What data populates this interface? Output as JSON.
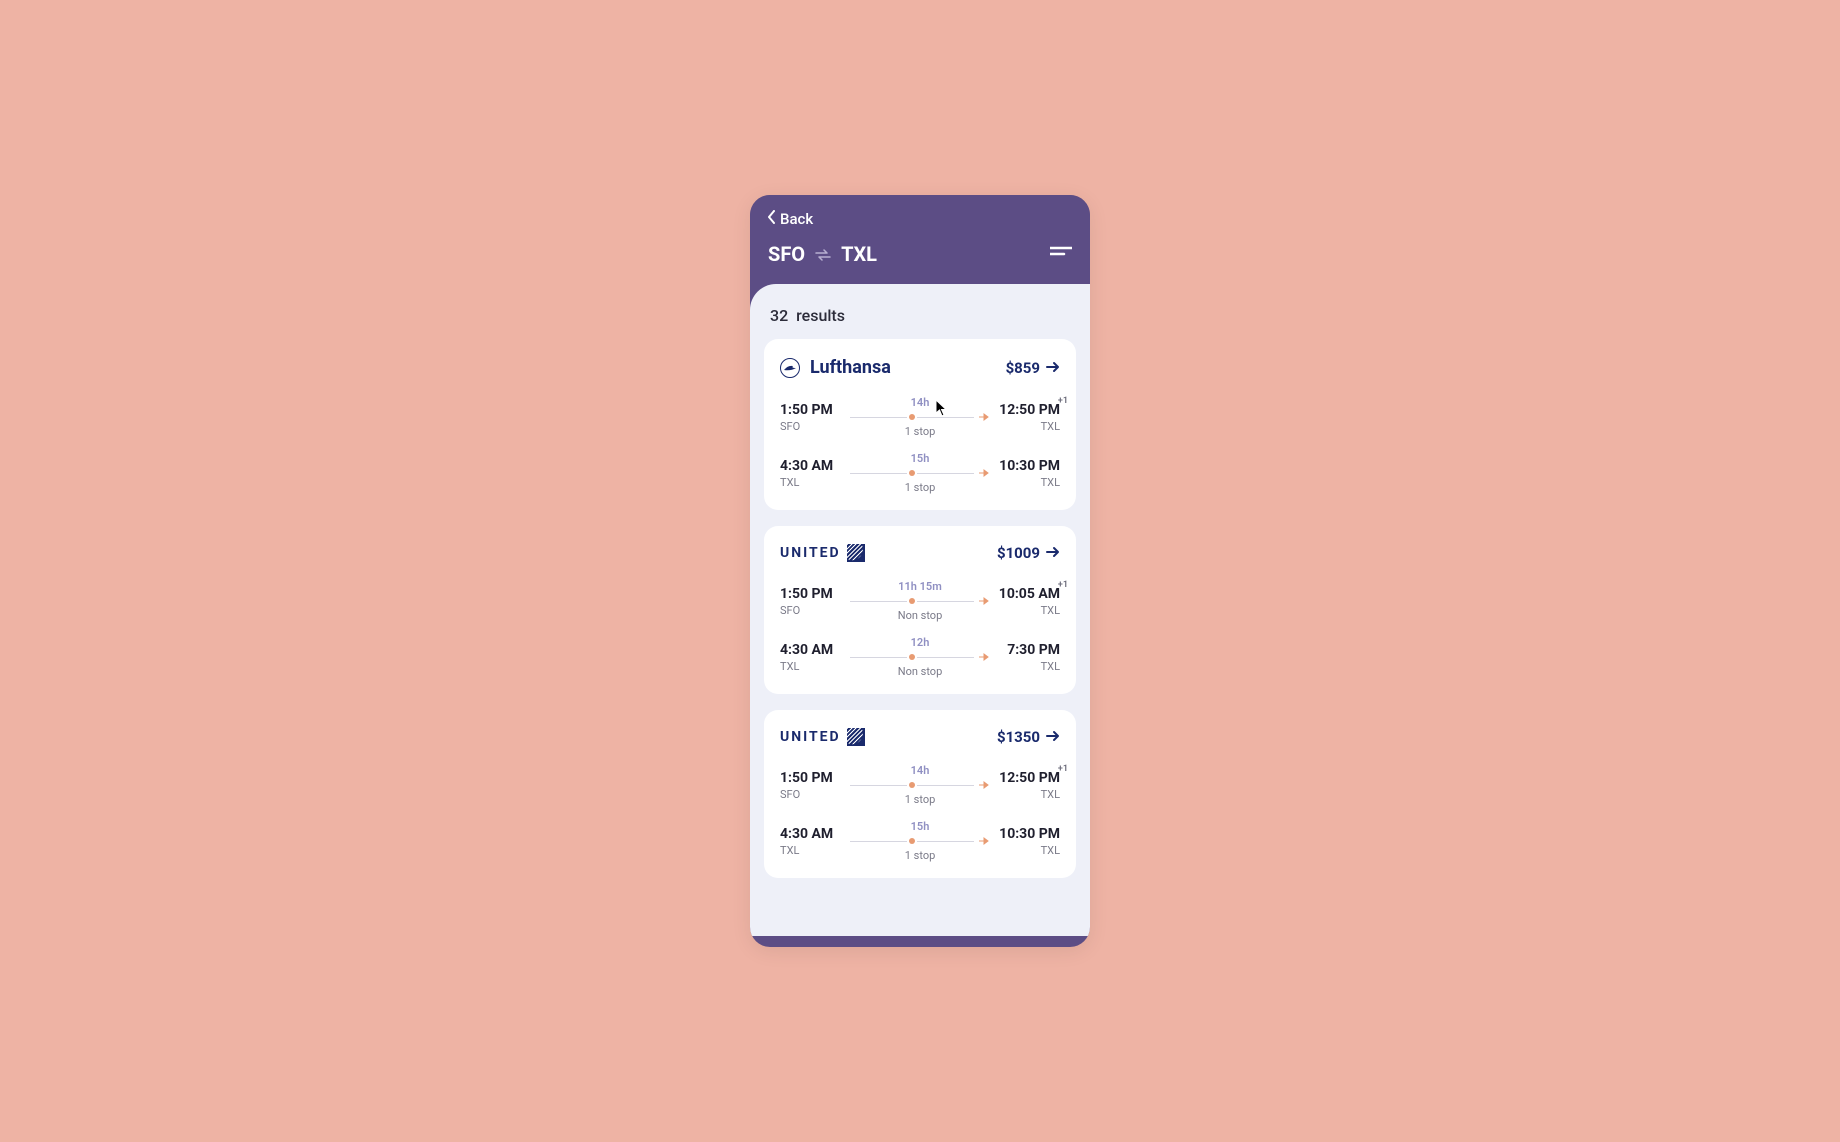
{
  "header": {
    "back_label": "Back",
    "origin": "SFO",
    "destination": "TXL"
  },
  "results": {
    "count": "32",
    "label": "results"
  },
  "flights": [
    {
      "airline_key": "lufthansa",
      "airline_label": "Lufthansa",
      "price": "$859",
      "legs": [
        {
          "dep_time": "1:50 PM",
          "dep_code": "SFO",
          "duration": "14h",
          "stops": "1 stop",
          "arr_time": "12:50 PM",
          "arr_code": "TXL",
          "plus_day": "+1"
        },
        {
          "dep_time": "4:30 AM",
          "dep_code": "TXL",
          "duration": "15h",
          "stops": "1 stop",
          "arr_time": "10:30 PM",
          "arr_code": "TXL",
          "plus_day": ""
        }
      ]
    },
    {
      "airline_key": "united",
      "airline_label": "UNITED",
      "price": "$1009",
      "legs": [
        {
          "dep_time": "1:50 PM",
          "dep_code": "SFO",
          "duration": "11h 15m",
          "stops": "Non stop",
          "arr_time": "10:05 AM",
          "arr_code": "TXL",
          "plus_day": "+1"
        },
        {
          "dep_time": "4:30 AM",
          "dep_code": "TXL",
          "duration": "12h",
          "stops": "Non stop",
          "arr_time": "7:30 PM",
          "arr_code": "TXL",
          "plus_day": ""
        }
      ]
    },
    {
      "airline_key": "united",
      "airline_label": "UNITED",
      "price": "$1350",
      "legs": [
        {
          "dep_time": "1:50 PM",
          "dep_code": "SFO",
          "duration": "14h",
          "stops": "1 stop",
          "arr_time": "12:50 PM",
          "arr_code": "TXL",
          "plus_day": "+1"
        },
        {
          "dep_time": "4:30 AM",
          "dep_code": "TXL",
          "duration": "15h",
          "stops": "1 stop",
          "arr_time": "10:30 PM",
          "arr_code": "TXL",
          "plus_day": ""
        }
      ]
    }
  ]
}
